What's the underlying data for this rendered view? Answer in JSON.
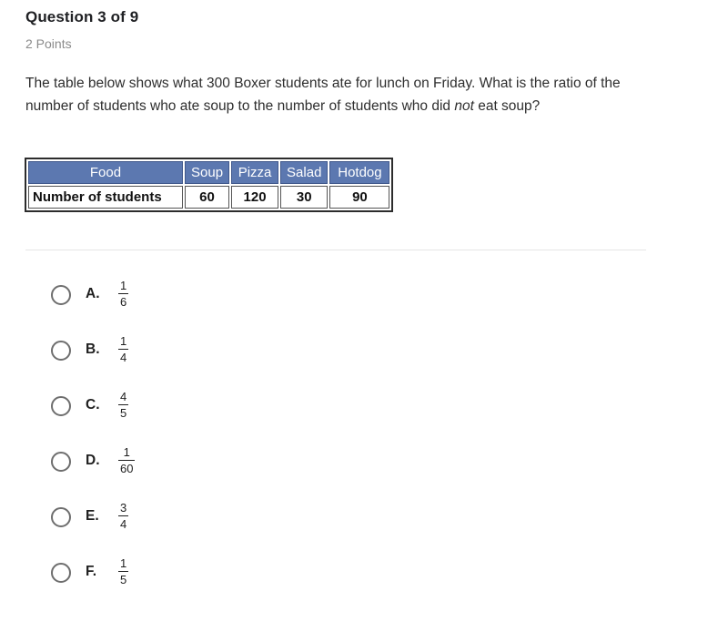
{
  "header": {
    "title": "Question 3 of 9",
    "points": "2 Points"
  },
  "prompt": {
    "part1": "The table below shows what 300 Boxer students ate for lunch on Friday. What is the ratio of the number of students who ate soup to the number of students who did ",
    "emphasis": "not",
    "part2": " eat soup?"
  },
  "table": {
    "header": [
      "Food",
      "Soup",
      "Pizza",
      "Salad",
      "Hotdog"
    ],
    "row": [
      "Number of students",
      "60",
      "120",
      "30",
      "90"
    ],
    "header_bg": "#5c78b0",
    "header_text_color": "#ffffff"
  },
  "options": [
    {
      "letter": "A.",
      "numerator": "1",
      "denominator": "6"
    },
    {
      "letter": "B.",
      "numerator": "1",
      "denominator": "4"
    },
    {
      "letter": "C.",
      "numerator": "4",
      "denominator": "5"
    },
    {
      "letter": "D.",
      "numerator": "1",
      "denominator": "60"
    },
    {
      "letter": "E.",
      "numerator": "3",
      "denominator": "4"
    },
    {
      "letter": "F.",
      "numerator": "1",
      "denominator": "5"
    }
  ]
}
